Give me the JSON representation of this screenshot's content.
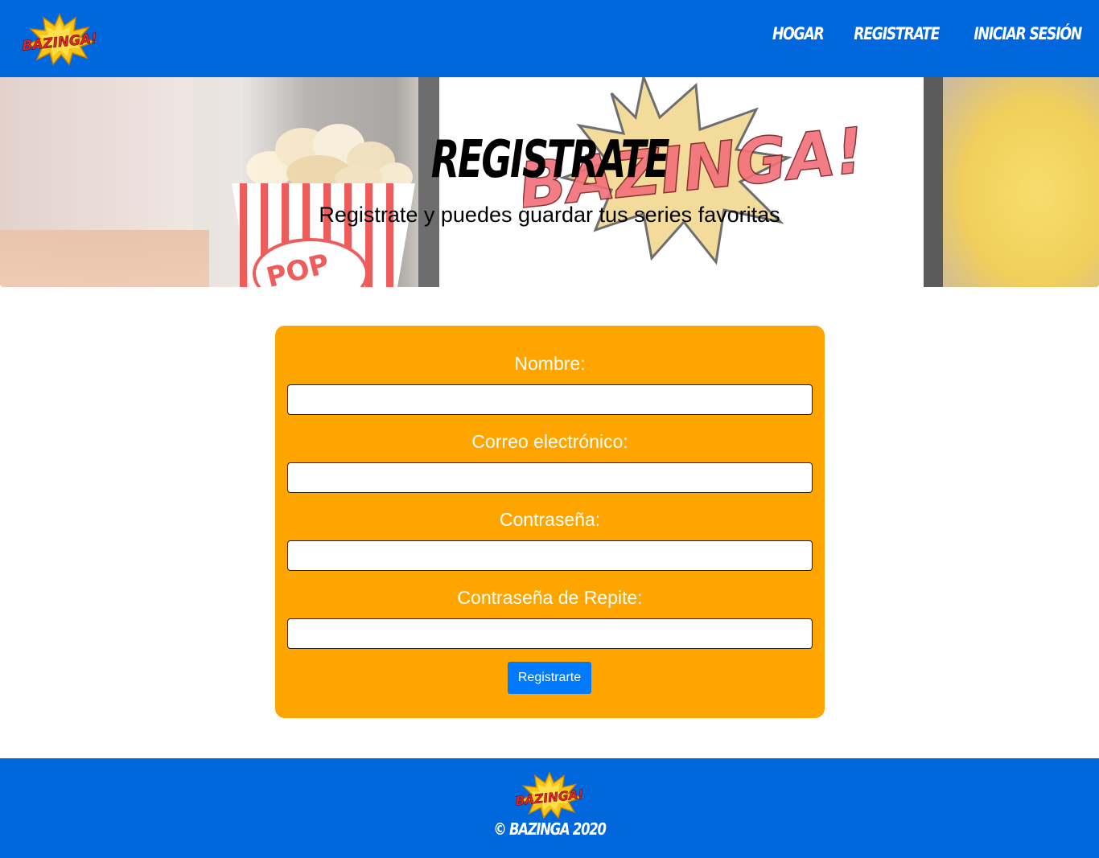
{
  "header": {
    "logo_text": "BAZINGA!",
    "nav": [
      {
        "label": "HOGAR"
      },
      {
        "label": "REGISTRATE"
      },
      {
        "label": "INICIAR SESIÓN"
      }
    ]
  },
  "hero": {
    "title": "REGISTRATE",
    "subtitle": "Registrate y puedes guardar tus series favoritas",
    "background_text": "BAZINGA!"
  },
  "form": {
    "fields": [
      {
        "label": "Nombre:",
        "value": ""
      },
      {
        "label": "Correo electrónico:",
        "value": ""
      },
      {
        "label": "Contraseña:",
        "value": ""
      },
      {
        "label": "Contraseña de Repite:",
        "value": ""
      }
    ],
    "submit_label": "Registrarte"
  },
  "footer": {
    "logo_text": "BAZINGA!",
    "copyright": "© BAZINGA 2020"
  },
  "colors": {
    "brand_blue": "#0068dc",
    "card_orange": "#ffa500",
    "button_blue": "#007bff"
  }
}
